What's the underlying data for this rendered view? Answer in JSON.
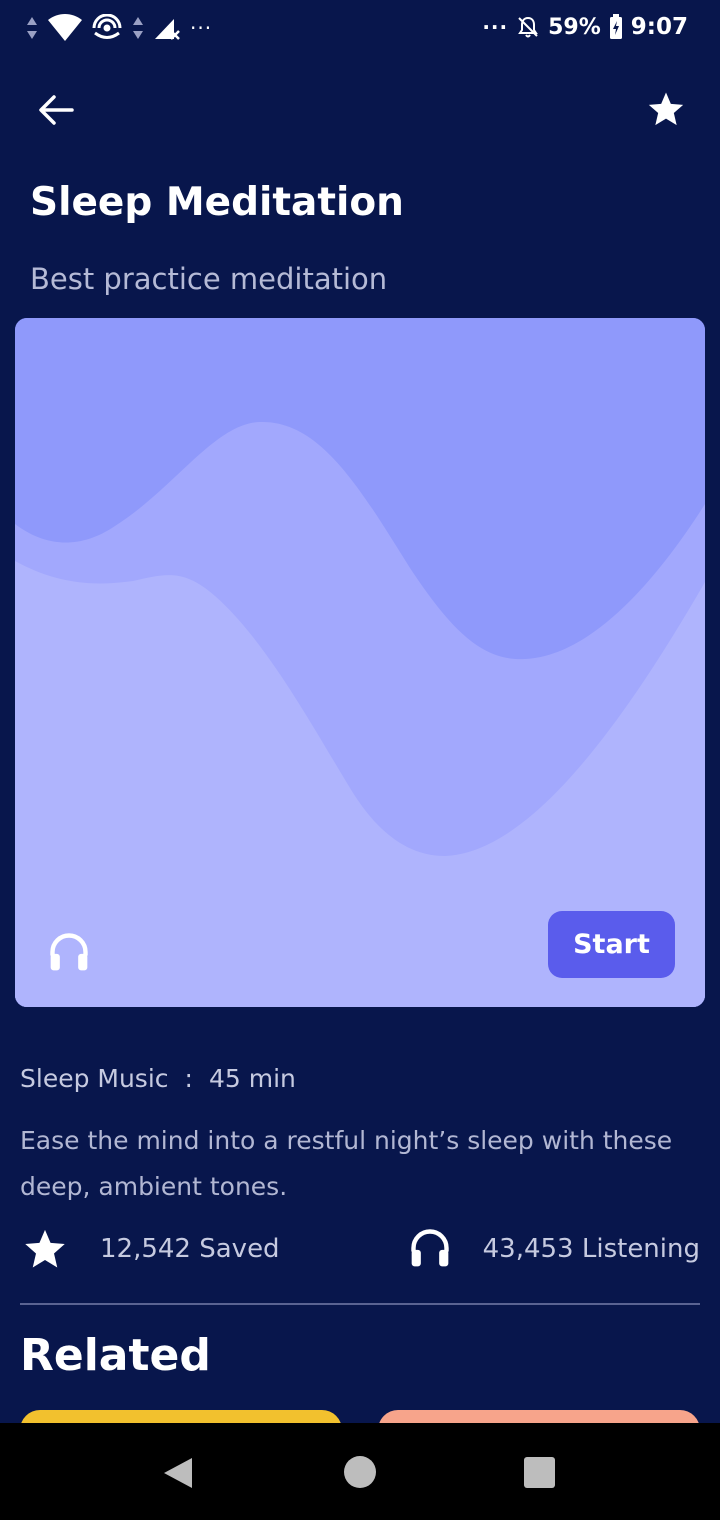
{
  "status_bar": {
    "battery": "59%",
    "time": "9:07",
    "left_icons": [
      "data-arrows-icon",
      "wifi-icon",
      "hotspot-icon",
      "data-arrows-icon",
      "signal-no-service-icon",
      "more-dots-icon"
    ],
    "right_icons": [
      "more-dots-icon",
      "alarm-off-icon",
      "battery-charging-icon"
    ]
  },
  "header": {
    "back_icon": "arrow-left-icon",
    "favorite_icon": "star-icon"
  },
  "title": "Sleep Meditation",
  "subtitle": "Best practice meditation",
  "hero": {
    "icon": "headphones-icon",
    "start_label": "Start",
    "colors": {
      "background": "#8f99fb",
      "wave_middle": "#a2a8fd",
      "wave_front": "#afb4fd",
      "button": "#5a5cec"
    }
  },
  "info": {
    "label": "Sleep Music",
    "separator": ":",
    "duration": "45 min"
  },
  "description": "Ease the mind into a restful night’s sleep with these deep, ambient tones.",
  "stats": {
    "saved": "12,542 Saved",
    "listening": "43,453 Listening",
    "saved_icon": "star-icon",
    "listening_icon": "headphones-icon"
  },
  "related": {
    "title": "Related",
    "card_colors": [
      "#f2c12e",
      "#f7a48b"
    ]
  },
  "nav": {
    "back_icon": "triangle-back-icon",
    "home_icon": "circle-home-icon",
    "recents_icon": "square-recents-icon"
  },
  "colors": {
    "background": "#08164c",
    "text_muted": "#b5bad6",
    "divider": "#5a6392"
  }
}
